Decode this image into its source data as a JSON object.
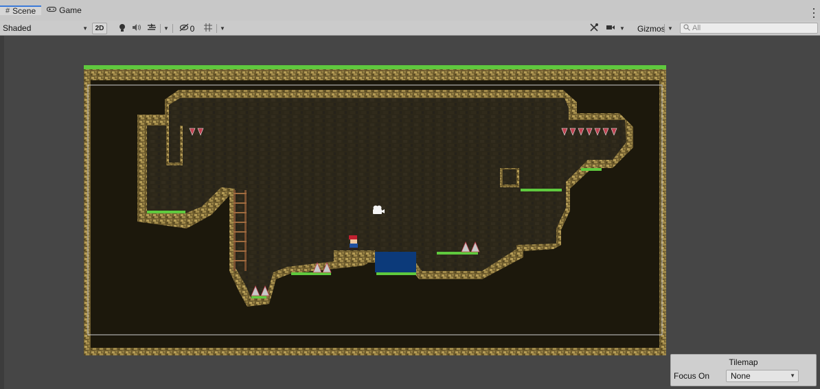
{
  "tabs": [
    {
      "label": "Scene",
      "icon": "grid-icon",
      "active": true
    },
    {
      "label": "Game",
      "icon": "gamepad-icon",
      "active": false
    }
  ],
  "toolbar": {
    "shading_mode": "Shaded",
    "mode_2d_label": "2D",
    "hidden_count": "0",
    "gizmos_label": "Gizmos",
    "search_placeholder": "All"
  },
  "overlay": {
    "title": "Tilemap",
    "focus_label": "Focus On",
    "focus_value": "None"
  },
  "colors": {
    "grass": "#5fc93e",
    "rock_border": "#b49a52",
    "cave_wall": "#2d281a",
    "background": "#1c180c",
    "water": "#0c3a7a",
    "spike": "#c04050",
    "ladder": "#7a5030",
    "tab_accent": "#3a79d8"
  }
}
